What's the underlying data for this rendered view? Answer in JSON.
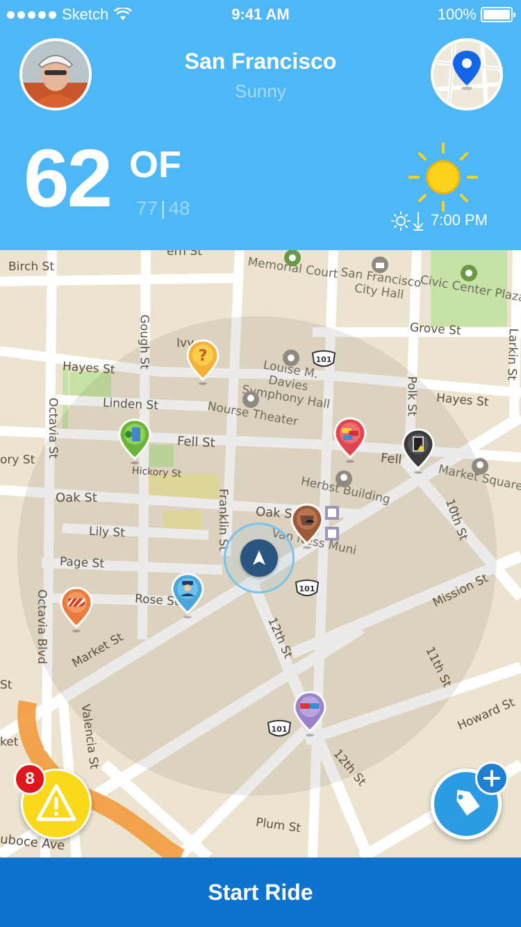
{
  "status_bar": {
    "carrier": "Sketch",
    "time": "9:41 AM",
    "battery": "100%"
  },
  "header": {
    "city": "San Francisco",
    "condition": "Sunny",
    "temperature": "62",
    "unit": "OF",
    "high": "77",
    "low": "48",
    "sunset_time": "7:00 PM",
    "avatar_icon": "user-avatar",
    "map_icon": "map-pin-icon",
    "weather_icon": "sun-icon"
  },
  "map": {
    "streets": {
      "birch": "Birch St",
      "hayes_w": "Hayes St",
      "hayes_e": "Hayes St",
      "linden": "Linden St",
      "fell_w": "Fell St",
      "fell_e": "Fell",
      "hickory": "Hickory St",
      "oak_w": "Oak St",
      "oak_e": "Oak St",
      "lily": "Lily St",
      "page": "Page St",
      "rose": "Rose St",
      "market": "Market St",
      "gough": "Gough St",
      "franklin": "Franklin St",
      "octavia_st": "Octavia St",
      "octavia_blvd": "Octavia Blvd",
      "valencia": "Valencia St",
      "polk": "Polk St",
      "larkin": "Larkin St",
      "grove": "Grove St",
      "tenth": "10th St",
      "eleventh": "11th St",
      "twelfth_a": "12th St",
      "twelfth_b": "12th St",
      "mission": "Mission St",
      "howard": "Howard St",
      "plum": "Plum St",
      "duboce": "uboce Ave",
      "ivy": "Ivy",
      "ory": "ory St",
      "ket": "ket",
      "st": "St",
      "top": "ern St"
    },
    "places": {
      "memorial": "Memorial Court",
      "city_hall": "San Francisco City Hall",
      "civic": "Civic Center Plaza",
      "symphony": "Louise M. Davies Symphony Hall",
      "nourse": "Nourse Theater",
      "herbst": "Herbst Building",
      "market_square": "Market Square",
      "van_ness": "Van Ness Muni"
    },
    "highway": "101",
    "alert_count": "8"
  },
  "bottom": {
    "start_label": "Start Ride"
  },
  "colors": {
    "header_bg": "#4db8f5",
    "button_bg": "#0c74cf",
    "map_bg": "#ece4d1"
  }
}
